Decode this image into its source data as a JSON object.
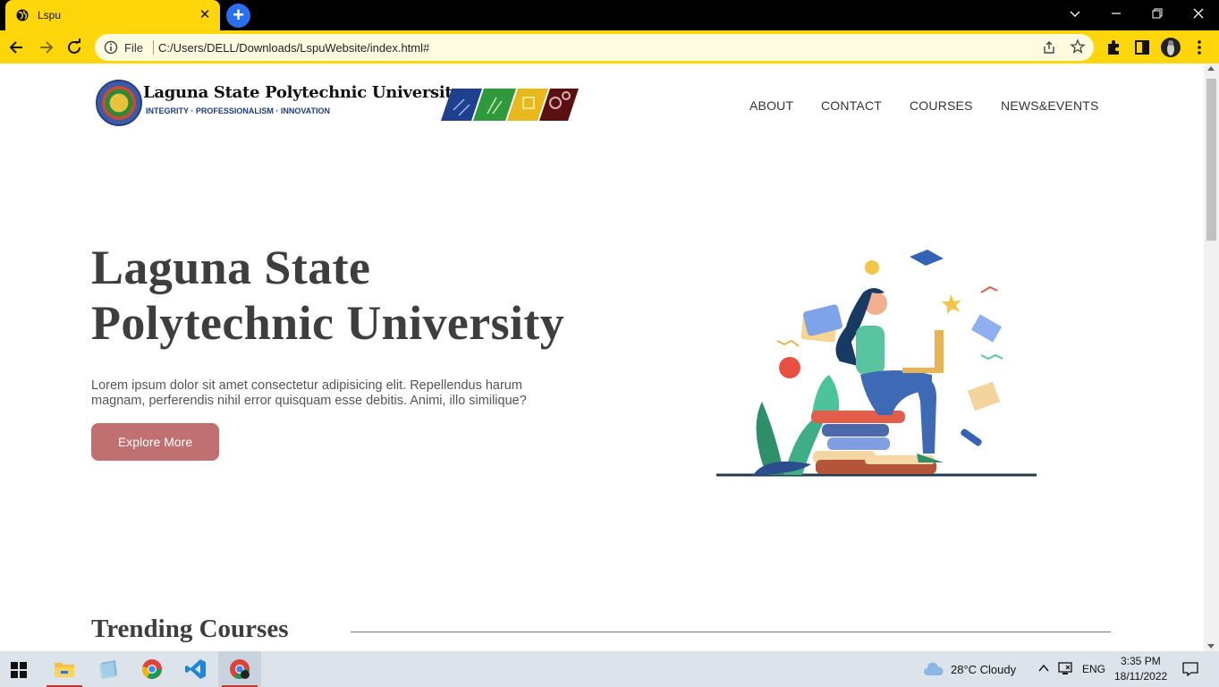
{
  "browser": {
    "tab_title": "Lspu",
    "tab_close": "✕",
    "new_tab": "+",
    "scheme_label": "File",
    "url": "C:/Users/DELL/Downloads/LspuWebsite/index.html#",
    "accent_color": "#ffd60a"
  },
  "site": {
    "logo_name": "Laguna State Polytechnic University",
    "logo_tagline": "INTEGRITY · PROFESSIONALISM · INNOVATION",
    "nav": [
      "ABOUT",
      "CONTACT",
      "COURSES",
      "NEWS&EVENTS"
    ],
    "hero_title_line1": "Laguna State",
    "hero_title_line2": "Polytechnic University",
    "hero_text": "Lorem ipsum dolor sit amet consectetur adipisicing elit. Repellendus harum magnam, perferendis nihil error quisquam esse debitis. Animi, illo similique?",
    "cta_label": "Explore More",
    "cta_color": "#c07070",
    "section_title": "Trending Courses"
  },
  "taskbar": {
    "weather": "28°C  Cloudy",
    "language": "ENG",
    "time": "3:35 PM",
    "date": "18/11/2022"
  }
}
